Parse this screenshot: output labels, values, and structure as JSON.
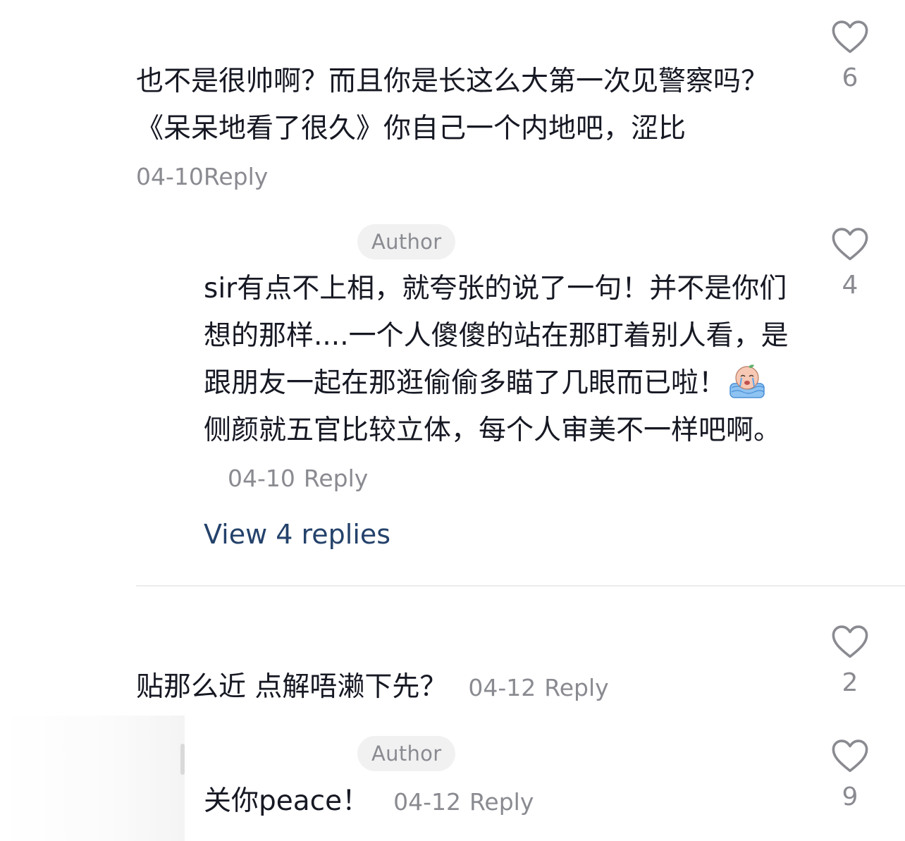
{
  "comments": [
    {
      "text": "也不是很帅啊？而且你是长这么大第一次见警察吗？《呆呆地看了很久》你自己一个内地吧，涩比",
      "date": "04-10",
      "reply_label": "Reply",
      "likes": "6"
    },
    {
      "badge": "Author",
      "text_before_emoji": "sir有点不上相，就夸张的说了一句！并不是你们想的那样....一个人傻傻的站在那盯着别人看，是跟朋友一起在那逛偷偷多瞄了几眼而已啦！",
      "text_after_emoji": "侧颜就五官比较立体，每个人审美不一样吧啊。",
      "emoji": "crying-face-emoji",
      "date": "04-10",
      "reply_label": "Reply",
      "likes": "4",
      "view_replies": "View 4 replies"
    },
    {
      "text": "贴那么近 点解唔濑下先？",
      "date": "04-12",
      "reply_label": "Reply",
      "likes": "2"
    },
    {
      "badge": "Author",
      "text": "关你peace！",
      "date": "04-12",
      "reply_label": "Reply",
      "likes": "9"
    }
  ],
  "colors": {
    "text": "#161823",
    "meta": "#8a8b91",
    "link": "#24426b",
    "badge_bg": "#f1f1f2"
  }
}
